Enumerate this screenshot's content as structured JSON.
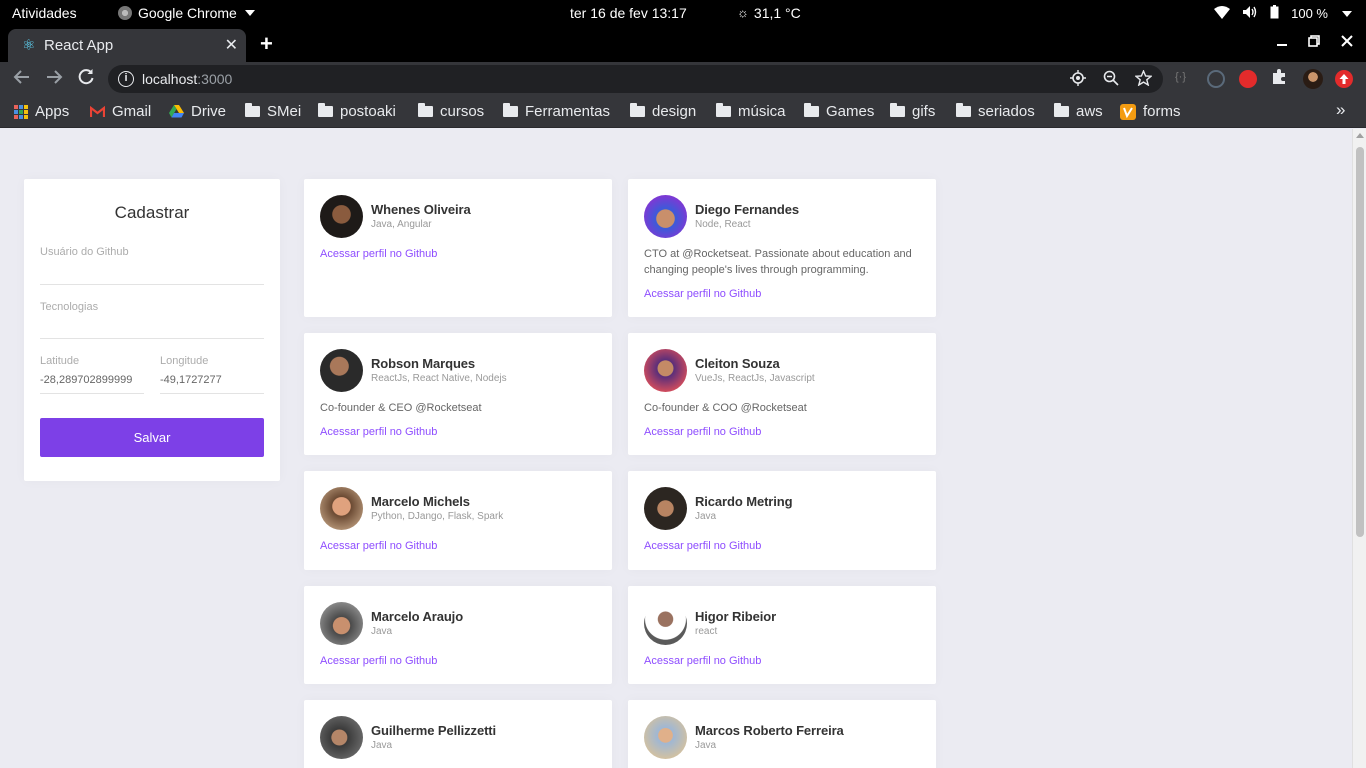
{
  "system_bar": {
    "activities": "Atividades",
    "app_name": "Google Chrome",
    "datetime": "ter 16 de fev  13:17",
    "weather": "31,1 °C",
    "battery": "100 %"
  },
  "browser": {
    "tab_title": "React App",
    "url_host": "localhost",
    "url_port": ":3000",
    "bookmarks": [
      {
        "label": "Apps",
        "icon": "apps-grid-icon"
      },
      {
        "label": "Gmail",
        "icon": "gmail-icon"
      },
      {
        "label": "Drive",
        "icon": "drive-icon"
      },
      {
        "label": "SMei",
        "icon": "folder-icon"
      },
      {
        "label": "postoaki",
        "icon": "folder-icon"
      },
      {
        "label": "cursos",
        "icon": "folder-icon"
      },
      {
        "label": "Ferramentas",
        "icon": "folder-icon"
      },
      {
        "label": "design",
        "icon": "folder-icon"
      },
      {
        "label": "música",
        "icon": "folder-icon"
      },
      {
        "label": "Games",
        "icon": "folder-icon"
      },
      {
        "label": "gifs",
        "icon": "folder-icon"
      },
      {
        "label": "seriados",
        "icon": "folder-icon"
      },
      {
        "label": "aws",
        "icon": "folder-icon"
      },
      {
        "label": "forms",
        "icon": "forms-icon"
      }
    ]
  },
  "form": {
    "title": "Cadastrar",
    "github_user_label": "Usuário do Github",
    "github_user_value": "",
    "techs_label": "Tecnologias",
    "techs_value": "",
    "latitude_label": "Latitude",
    "latitude_value": "-28,289702899999",
    "longitude_label": "Longitude",
    "longitude_value": "-49,1727277",
    "save_label": "Salvar"
  },
  "link_text": "Acessar perfil no Github",
  "devs": [
    {
      "name": "Whenes Oliveira",
      "techs": "Java, Angular",
      "bio": ""
    },
    {
      "name": "Diego Fernandes",
      "techs": "Node, React",
      "bio": "CTO at @Rocketseat. Passionate about education and changing people's lives through programming."
    },
    {
      "name": "Robson Marques",
      "techs": "ReactJs, React Native, Nodejs",
      "bio": "Co-founder & CEO @Rocketseat"
    },
    {
      "name": "Cleiton Souza",
      "techs": "VueJs, ReactJs, Javascript",
      "bio": "Co-founder & COO @Rocketseat"
    },
    {
      "name": "Marcelo Michels",
      "techs": "Python, DJango, Flask, Spark",
      "bio": ""
    },
    {
      "name": "Ricardo Metring",
      "techs": "Java",
      "bio": ""
    },
    {
      "name": "Marcelo Araujo",
      "techs": "Java",
      "bio": ""
    },
    {
      "name": "Higor Ribeior",
      "techs": "react",
      "bio": ""
    },
    {
      "name": "Guilherme Pellizzetti",
      "techs": "Java",
      "bio": ""
    },
    {
      "name": "Marcos Roberto Ferreira",
      "techs": "Java",
      "bio": ""
    }
  ],
  "colors": {
    "accent": "#7d40e7",
    "link": "#8e4dff",
    "page_bg": "#ebebf2"
  }
}
